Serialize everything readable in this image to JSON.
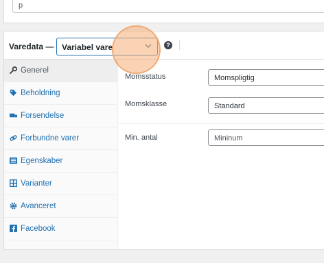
{
  "top": {
    "input_value": "p"
  },
  "header": {
    "title": "Varedata —",
    "product_type": "Variabel vare",
    "help_icon": "question-circle-icon"
  },
  "tabs": [
    {
      "label": "Generel",
      "icon": "wrench-icon",
      "active": true
    },
    {
      "label": "Beholdning",
      "icon": "tag-icon"
    },
    {
      "label": "Forsendelse",
      "icon": "truck-icon"
    },
    {
      "label": "Forbundne varer",
      "icon": "link-icon"
    },
    {
      "label": "Egenskaber",
      "icon": "list-icon"
    },
    {
      "label": "Varianter",
      "icon": "grid-icon"
    },
    {
      "label": "Avanceret",
      "icon": "gear-icon"
    },
    {
      "label": "Facebook",
      "icon": "facebook-icon"
    }
  ],
  "fields": {
    "tax_status": {
      "label": "Momsstatus",
      "value": "Momspligtig"
    },
    "tax_class": {
      "label": "Momsklasse",
      "value": "Standard"
    },
    "min_qty": {
      "label": "Min. antal",
      "placeholder": "Mininum"
    }
  },
  "colors": {
    "accent": "#2271b1",
    "highlight": "#f5ae78"
  }
}
